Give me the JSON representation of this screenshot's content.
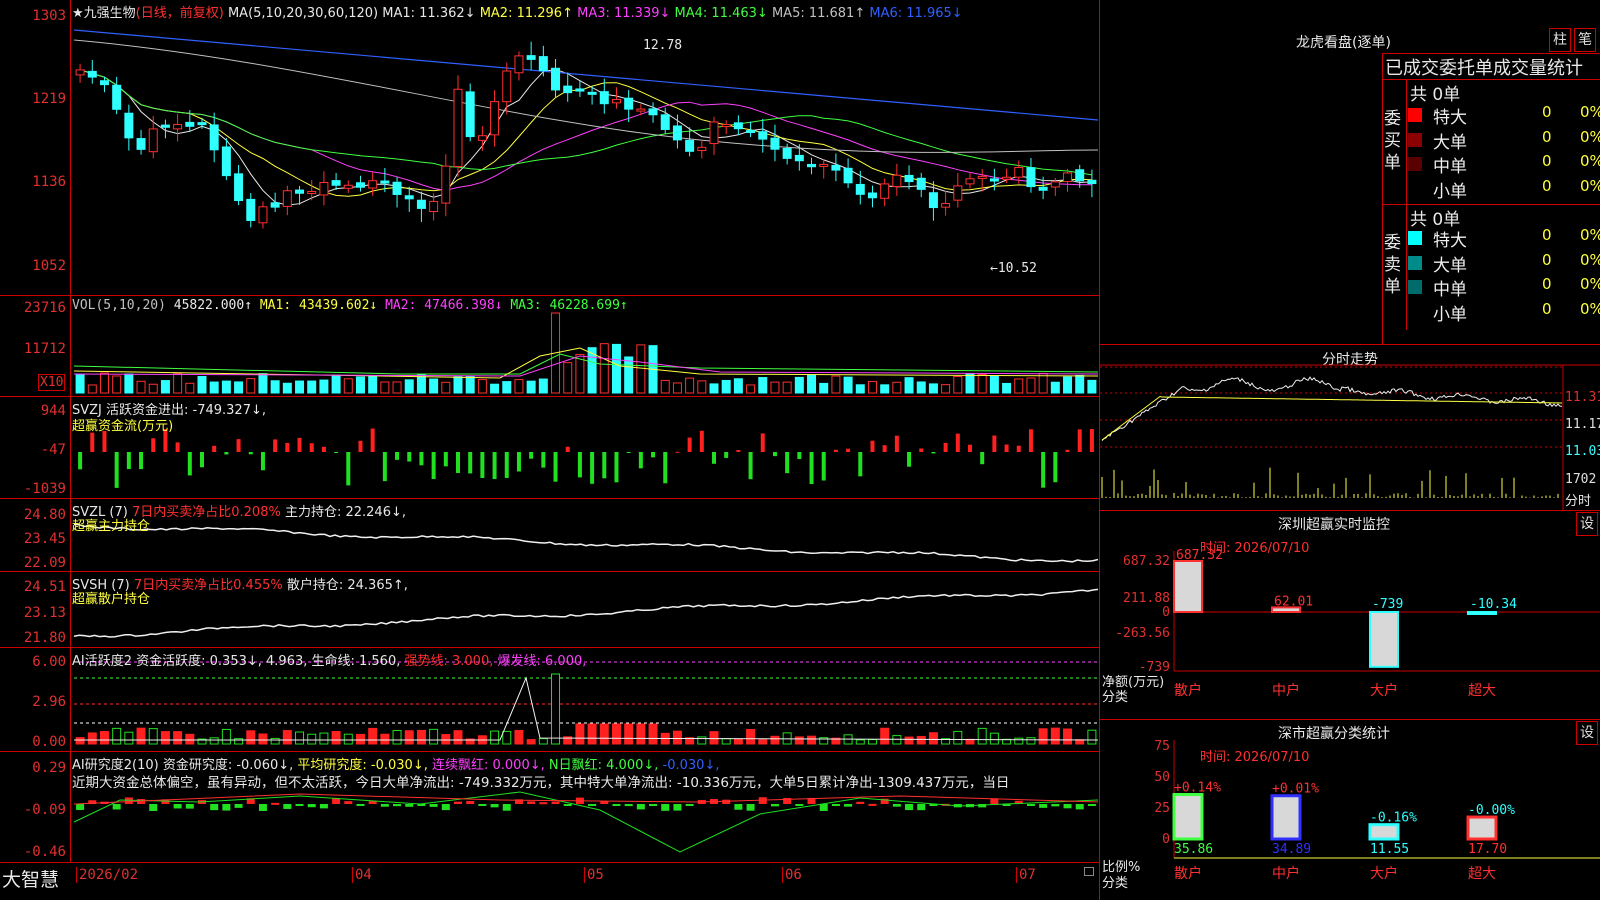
{
  "main": {
    "title": "★九强生物",
    "mode": "(日线，前复权)",
    "ma_label": "MA(5,10,20,30,60,120)",
    "ma": [
      {
        "label": "MA1: 11.362↓",
        "color": "#e8e8e8"
      },
      {
        "label": "MA2: 11.296↑",
        "color": "#ffff40"
      },
      {
        "label": "MA3: 11.339↓",
        "color": "#ff40ff"
      },
      {
        "label": "MA4: 11.463↓",
        "color": "#40ff40"
      },
      {
        "label": "MA5: 11.681↑",
        "color": "#c0c0c0"
      },
      {
        "label": "MA6: 11.965↓",
        "color": "#3060ff"
      }
    ],
    "y_ticks": [
      "1303",
      "1219",
      "1136",
      "1052"
    ],
    "hi_label": "12.78",
    "lo_label": "←10.52"
  },
  "vol": {
    "label": "VOL(5,10,20)",
    "value": "45822.000↑",
    "ma1": "MA1: 43439.602↓",
    "ma2": "MA2: 47466.398↓",
    "ma3": "MA3: 46228.699↑",
    "y_ticks": [
      "23716",
      "11712"
    ],
    "unit": "X10"
  },
  "svzj": {
    "label": "SVZJ  活跃资金进出: -749.327↓,",
    "sub": "超赢资金流(万元)",
    "y_ticks": [
      "944",
      "-47",
      "-1039"
    ]
  },
  "svzl": {
    "label": "SVZL (7)",
    "ratio": "7日内买卖净占比0.208%",
    "hold": "主力持仓: 22.246↓,",
    "sub": "超赢主力持仓",
    "y_ticks": [
      "24.80",
      "23.45",
      "22.09"
    ]
  },
  "svsh": {
    "label": "SVSH (7)",
    "ratio": "7日内买卖净占比0.455%",
    "hold": "散户持仓: 24.365↑,",
    "sub": "超赢散户持仓",
    "y_ticks": [
      "24.51",
      "23.13",
      "21.80"
    ]
  },
  "ai1": {
    "label": "AI活跃度2 资金活跃度: 0.353↓, 4.963, 生命线: 1.560,",
    "strong": "强势线: 3.000,",
    "burst": "爆发线: 6.000,",
    "y_ticks": [
      "6.00",
      "2.96",
      "0.00"
    ]
  },
  "ai2": {
    "label": "AI研究度2(10) 资金研究度: -0.060↓,",
    "avg": "平均研究度: -0.030↓,",
    "cont": "连续飘红: 0.000↓,",
    "nday": "N日飘红: 4.000↓,",
    "last": "-0.030↓,",
    "desc": "近期大资金总体偏空，虽有异动，但不太活跃，今日大单净流出: -749.332万元，其中特大单净流出: -10.336万元，大单5日累计净出-1309.437万元，当日",
    "y_ticks": [
      "0.29",
      "-0.09",
      "-0.46"
    ]
  },
  "xaxis": {
    "brand": "大智慧",
    "ticks": [
      "2026/02",
      "04",
      "05",
      "06",
      "07"
    ]
  },
  "dragon": {
    "title": "龙虎看盘(逐单)",
    "btn1": "柱",
    "btn2": "笔",
    "subtitle": "已成交委托单成交量统计",
    "buy_side": "委买单",
    "sell_side": "委卖单",
    "buy_total": "共 0单",
    "sell_total": "共 0单",
    "buy_rows": [
      {
        "name": "特大",
        "v": "0",
        "p": "0%",
        "color": "#ff0000"
      },
      {
        "name": "大单",
        "v": "0",
        "p": "0%",
        "color": "#8b0000"
      },
      {
        "name": "中单",
        "v": "0",
        "p": "0%",
        "color": "#5a0000"
      },
      {
        "name": "小单",
        "v": "0",
        "p": "0%",
        "color": "#000000"
      }
    ],
    "sell_rows": [
      {
        "name": "特大",
        "v": "0",
        "p": "0%",
        "color": "#00ffff"
      },
      {
        "name": "大单",
        "v": "0",
        "p": "0%",
        "color": "#008b8b"
      },
      {
        "name": "中单",
        "v": "0",
        "p": "0%",
        "color": "#006b6b"
      },
      {
        "name": "小单",
        "v": "0",
        "p": "0%",
        "color": "#000000"
      }
    ]
  },
  "intraday": {
    "title": "分时走势",
    "y_ticks": [
      "11.31",
      "11.17",
      "11.03"
    ],
    "vol_tick": "1702",
    "unit": "分时"
  },
  "sz_monitor": {
    "title": "深圳超赢实时监控",
    "btn": "设",
    "time": "时间: 2026/07/10",
    "y_ticks": [
      "687.32",
      "211.88",
      "0",
      "-263.56",
      "-739"
    ],
    "ylabel": "净额(万元)",
    "xlabel": "分类",
    "categories": [
      "散户",
      "中户",
      "大户",
      "超大"
    ],
    "values_label": [
      "687.32",
      "62.01",
      "-739",
      "-10.34"
    ]
  },
  "sz_class": {
    "title": "深市超赢分类统计",
    "btn": "设",
    "time": "时间: 2026/07/10",
    "y_ticks": [
      "75",
      "50",
      "25",
      "0"
    ],
    "ylabel": "比例%",
    "xlabel": "分类",
    "categories": [
      "散户",
      "中户",
      "大户",
      "超大"
    ],
    "changes": [
      "+0.14%",
      "+0.01%",
      "-0.16%",
      "-0.00%"
    ],
    "values": [
      "35.86",
      "34.89",
      "11.55",
      "17.70"
    ]
  }
}
